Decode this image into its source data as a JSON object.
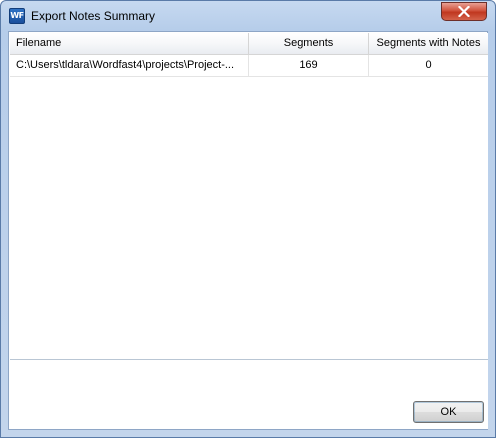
{
  "window": {
    "title": "Export Notes Summary",
    "app_icon_label": "WF",
    "close_icon": "close-icon"
  },
  "grid": {
    "columns": [
      "Filename",
      "Segments",
      "Segments with Notes"
    ],
    "rows": [
      {
        "filename": "C:\\Users\\tldara\\Wordfast4\\projects\\Project-...",
        "segments": "169",
        "segments_with_notes": "0"
      }
    ]
  },
  "footer": {
    "ok_label": "OK"
  },
  "colors": {
    "title_bar": "#b6cdea",
    "close_button": "#c0371f",
    "grid_border": "#d5d5d5"
  }
}
